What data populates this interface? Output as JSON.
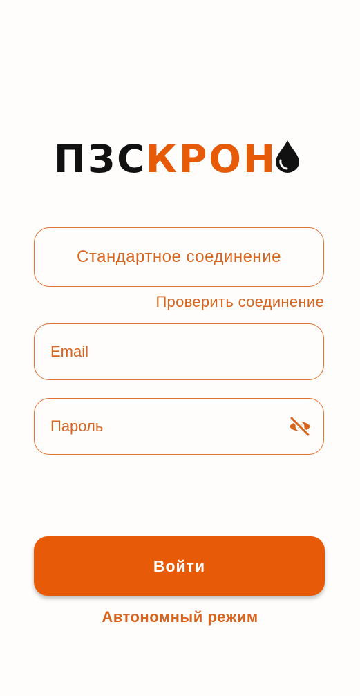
{
  "logo": {
    "part1": "ПЗС",
    "part2": "КРОН",
    "icon": "drop-icon"
  },
  "connection": {
    "value": "Стандартное соединение",
    "check_link": "Проверить соединение"
  },
  "email": {
    "placeholder": "Email"
  },
  "password": {
    "placeholder": "Пароль",
    "toggle_icon": "eye-off-icon"
  },
  "login_button": "Войти",
  "offline_link": "Автономный режим",
  "colors": {
    "accent": "#e65a08",
    "text_accent": "#d8631d",
    "logo_dark": "#111111",
    "background": "#fffdfc"
  }
}
